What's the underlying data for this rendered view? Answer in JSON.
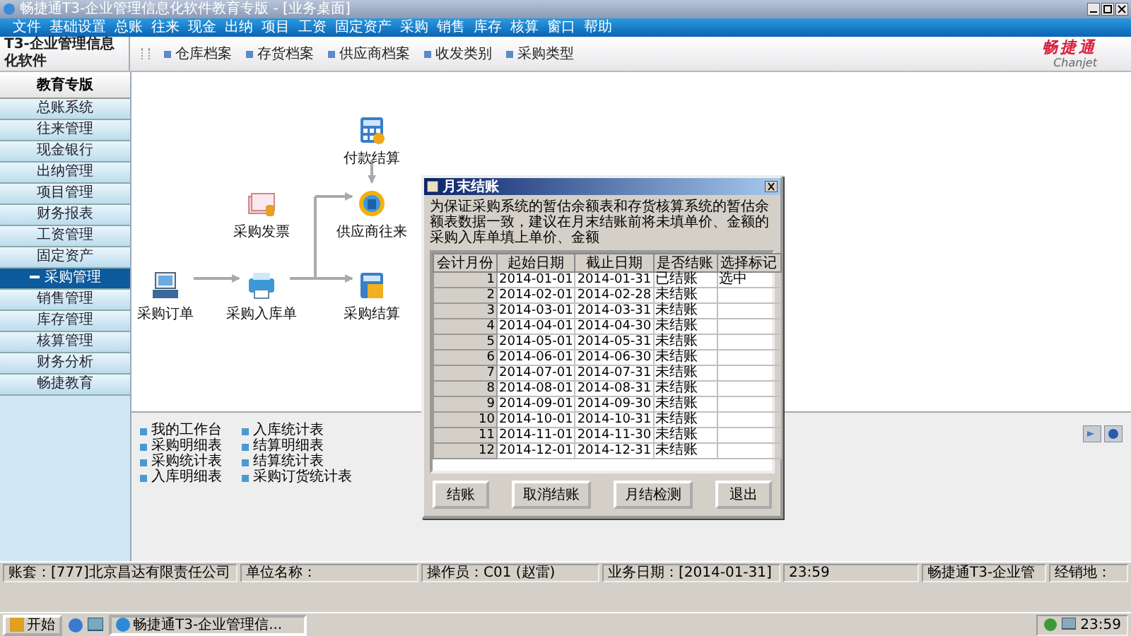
{
  "title_bar": {
    "title": "畅捷通T3-企业管理信息化软件教育专版 - [业务桌面]"
  },
  "menu": [
    "文件",
    "基础设置",
    "总账",
    "往来",
    "现金",
    "出纳",
    "项目",
    "工资",
    "固定资产",
    "采购",
    "销售",
    "库存",
    "核算",
    "窗口",
    "帮助"
  ],
  "sidebar": {
    "brand": "T3-企业管理信息化软件",
    "edition": "教育专版",
    "items": [
      {
        "label": "总账系统",
        "selected": false
      },
      {
        "label": "往来管理",
        "selected": false
      },
      {
        "label": "现金银行",
        "selected": false
      },
      {
        "label": "出纳管理",
        "selected": false
      },
      {
        "label": "项目管理",
        "selected": false
      },
      {
        "label": "财务报表",
        "selected": false
      },
      {
        "label": "工资管理",
        "selected": false
      },
      {
        "label": "固定资产",
        "selected": false
      },
      {
        "label": "采购管理",
        "selected": true
      },
      {
        "label": "销售管理",
        "selected": false
      },
      {
        "label": "库存管理",
        "selected": false
      },
      {
        "label": "核算管理",
        "selected": false
      },
      {
        "label": "财务分析",
        "selected": false
      },
      {
        "label": "畅捷教育",
        "selected": false
      }
    ]
  },
  "toolbar": [
    "仓库档案",
    "存货档案",
    "供应商档案",
    "收发类别",
    "采购类型"
  ],
  "logo": {
    "name": "畅捷通",
    "sub": "Chanjet"
  },
  "diagram": {
    "nodes": [
      {
        "label": "付款结算",
        "kind": "payment"
      },
      {
        "label": "采购发票",
        "kind": "invoice"
      },
      {
        "label": "供应商往来",
        "kind": "supplier"
      },
      {
        "label": "采购订单",
        "kind": "order"
      },
      {
        "label": "采购入库单",
        "kind": "receipt"
      },
      {
        "label": "采购结算",
        "kind": "settlement"
      }
    ]
  },
  "report_links": [
    "我的工作台",
    "采购明细表",
    "采购统计表",
    "入库明细表",
    "入库统计表",
    "结算明细表",
    "结算统计表",
    "采购订货统计表"
  ],
  "dialog": {
    "title": "月末结账",
    "message": "为保证采购系统的暂估余额表和存货核算系统的暂估余额表数据一致，建议在月末结账前将未填单价、金额的采购入库单填上单价、金额",
    "columns": [
      "会计月份",
      "起始日期",
      "截止日期",
      "是否结账",
      "选择标记"
    ],
    "rows": [
      [
        "1",
        "2014-01-01",
        "2014-01-31",
        "已结账",
        "选中"
      ],
      [
        "2",
        "2014-02-01",
        "2014-02-28",
        "未结账",
        ""
      ],
      [
        "3",
        "2014-03-01",
        "2014-03-31",
        "未结账",
        ""
      ],
      [
        "4",
        "2014-04-01",
        "2014-04-30",
        "未结账",
        ""
      ],
      [
        "5",
        "2014-05-01",
        "2014-05-31",
        "未结账",
        ""
      ],
      [
        "6",
        "2014-06-01",
        "2014-06-30",
        "未结账",
        ""
      ],
      [
        "7",
        "2014-07-01",
        "2014-07-31",
        "未结账",
        ""
      ],
      [
        "8",
        "2014-08-01",
        "2014-08-31",
        "未结账",
        ""
      ],
      [
        "9",
        "2014-09-01",
        "2014-09-30",
        "未结账",
        ""
      ],
      [
        "10",
        "2014-10-01",
        "2014-10-31",
        "未结账",
        ""
      ],
      [
        "11",
        "2014-11-01",
        "2014-11-30",
        "未结账",
        ""
      ],
      [
        "12",
        "2014-12-01",
        "2014-12-31",
        "未结账",
        ""
      ]
    ],
    "buttons": [
      "结账",
      "取消结账",
      "月结检测",
      "退出"
    ]
  },
  "status_bar": [
    "账套：[777]北京昌达有限责任公司",
    "单位名称：",
    "操作员：C01 (赵雷)",
    "业务日期：[2014-01-31]",
    "23:59",
    "畅捷通T3-企业管",
    "经销地："
  ],
  "taskbar": {
    "start": "开始",
    "task": "畅捷通T3-企业管理信...",
    "clock": "23:59"
  }
}
